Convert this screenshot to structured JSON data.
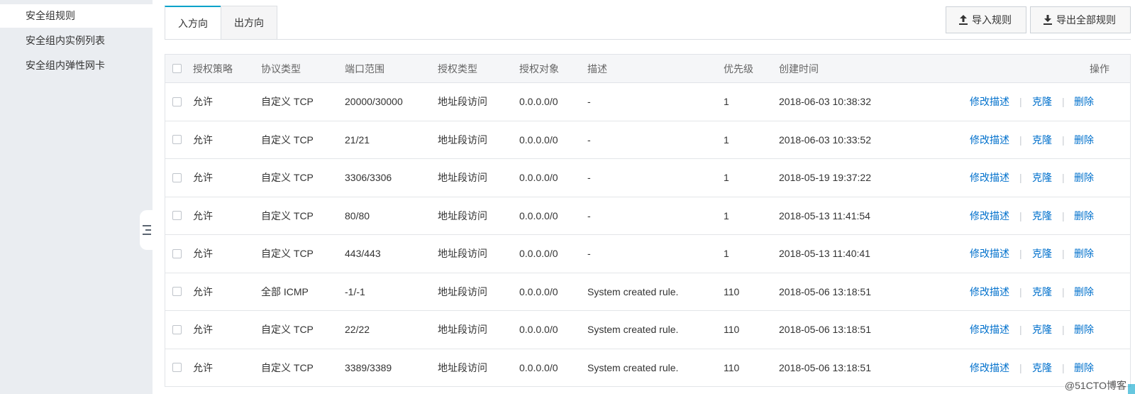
{
  "sidebar": {
    "items": [
      {
        "label": "安全组规则",
        "active": true
      },
      {
        "label": "安全组内实例列表",
        "active": false
      },
      {
        "label": "安全组内弹性网卡",
        "active": false
      }
    ]
  },
  "tabs": [
    {
      "label": "入方向",
      "active": true
    },
    {
      "label": "出方向",
      "active": false
    }
  ],
  "toolbar": {
    "import_label": "导入规则",
    "export_label": "导出全部规则"
  },
  "table": {
    "columns": [
      "授权策略",
      "协议类型",
      "端口范围",
      "授权类型",
      "授权对象",
      "描述",
      "优先级",
      "创建时间",
      "操作"
    ],
    "actions": [
      "修改描述",
      "克隆",
      "删除"
    ],
    "separator": "|",
    "rows": [
      {
        "policy": "允许",
        "protocol": "自定义 TCP",
        "port": "20000/30000",
        "auth_type": "地址段访问",
        "target": "0.0.0.0/0",
        "desc": "-",
        "priority": "1",
        "created": "2018-06-03 10:38:32"
      },
      {
        "policy": "允许",
        "protocol": "自定义 TCP",
        "port": "21/21",
        "auth_type": "地址段访问",
        "target": "0.0.0.0/0",
        "desc": "-",
        "priority": "1",
        "created": "2018-06-03 10:33:52"
      },
      {
        "policy": "允许",
        "protocol": "自定义 TCP",
        "port": "3306/3306",
        "auth_type": "地址段访问",
        "target": "0.0.0.0/0",
        "desc": "-",
        "priority": "1",
        "created": "2018-05-19 19:37:22"
      },
      {
        "policy": "允许",
        "protocol": "自定义 TCP",
        "port": "80/80",
        "auth_type": "地址段访问",
        "target": "0.0.0.0/0",
        "desc": "-",
        "priority": "1",
        "created": "2018-05-13 11:41:54"
      },
      {
        "policy": "允许",
        "protocol": "自定义 TCP",
        "port": "443/443",
        "auth_type": "地址段访问",
        "target": "0.0.0.0/0",
        "desc": "-",
        "priority": "1",
        "created": "2018-05-13 11:40:41"
      },
      {
        "policy": "允许",
        "protocol": "全部 ICMP",
        "port": "-1/-1",
        "auth_type": "地址段访问",
        "target": "0.0.0.0/0",
        "desc": "System created rule.",
        "priority": "110",
        "created": "2018-05-06 13:18:51"
      },
      {
        "policy": "允许",
        "protocol": "自定义 TCP",
        "port": "22/22",
        "auth_type": "地址段访问",
        "target": "0.0.0.0/0",
        "desc": "System created rule.",
        "priority": "110",
        "created": "2018-05-06 13:18:51"
      },
      {
        "policy": "允许",
        "protocol": "自定义 TCP",
        "port": "3389/3389",
        "auth_type": "地址段访问",
        "target": "0.0.0.0/0",
        "desc": "System created rule.",
        "priority": "110",
        "created": "2018-05-06 13:18:51"
      }
    ]
  },
  "watermark": "@51CTO博客",
  "colors": {
    "link": "#0070cc",
    "accent": "#00a2ca",
    "sidebar_bg": "#eaedf1"
  }
}
